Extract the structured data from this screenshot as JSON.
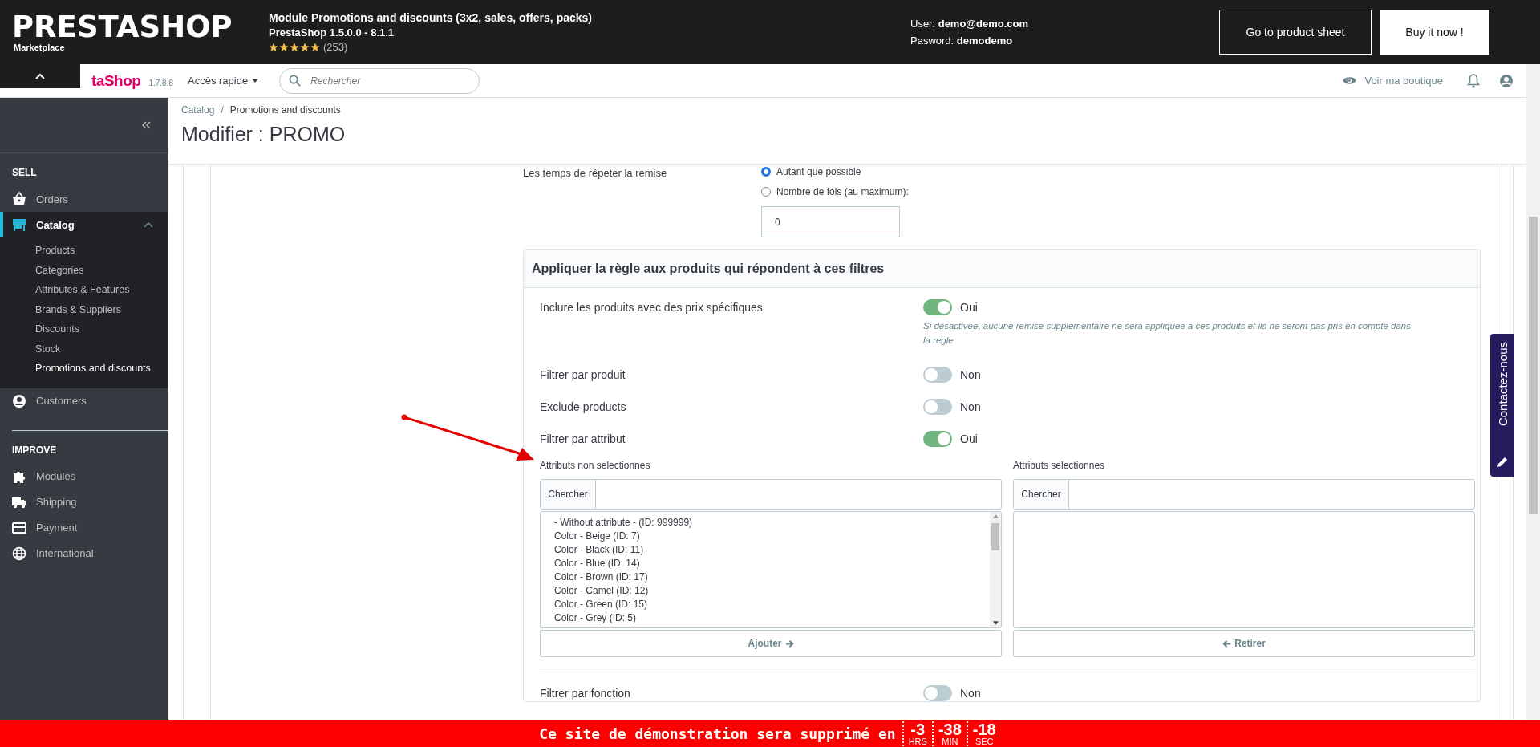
{
  "promo_bar": {
    "brand": "PRESTASHOP",
    "brand_sub": "Marketplace",
    "module_title": "Module Promotions and discounts (3x2, sales, offers, packs)",
    "compat": "PrestaShop 1.5.0.0 - 8.1.1",
    "stars": 5,
    "rating_count": "(253)",
    "user_label": "User:",
    "user": "demo@demo.com",
    "password_label": "Pasword:",
    "password": "demodemo",
    "buttons": [
      "Go to product sheet",
      "Buy it now !"
    ]
  },
  "header": {
    "logo_text": "taShop",
    "version": "1.7.8.8",
    "quick_access": "Accès rapide",
    "search": {
      "placeholder": "Rechercher"
    },
    "shop_link": "Voir ma boutique"
  },
  "sidebar": {
    "sections": [
      {
        "title": "SELL",
        "items": [
          {
            "label": "Orders",
            "selected": false,
            "expanded": false
          },
          {
            "label": "Catalog",
            "selected": true,
            "expanded": true,
            "children": [
              {
                "label": "Products",
                "selected": false
              },
              {
                "label": "Categories",
                "selected": false
              },
              {
                "label": "Attributes & Features",
                "selected": false
              },
              {
                "label": "Brands & Suppliers",
                "selected": false
              },
              {
                "label": "Discounts",
                "selected": false
              },
              {
                "label": "Stock",
                "selected": false
              },
              {
                "label": "Promotions and discounts",
                "selected": true
              }
            ]
          },
          {
            "label": "Customers",
            "selected": false,
            "expanded": false
          }
        ]
      },
      {
        "title": "IMPROVE",
        "items": [
          {
            "label": "Modules",
            "selected": false,
            "expanded": false
          },
          {
            "label": "Shipping",
            "selected": false,
            "expanded": false
          },
          {
            "label": "Payment",
            "selected": false,
            "expanded": false
          },
          {
            "label": "International",
            "selected": false,
            "expanded": false
          }
        ]
      }
    ]
  },
  "breadcrumb": [
    "Catalog",
    "Promotions and discounts"
  ],
  "breadcrumb_separator": "/",
  "page_title": "Modifier : PROMO",
  "repeat": {
    "label": "Les temps de répeter la remise",
    "options": [
      {
        "label": "Autant que possible",
        "selected": true
      },
      {
        "label": "Nombre de fois (au maximum):",
        "selected": false
      }
    ],
    "value": "0"
  },
  "filters_panel": {
    "title": "Appliquer la règle aux produits qui répondent à ces filtres",
    "rows": [
      {
        "label": "Inclure les produits avec des prix spécifiques",
        "on": true,
        "state_text": "Oui",
        "help": "Si desactivee, aucune remise supplementaire ne sera appliquee a ces produits et ils ne seront pas pris en compte dans la regle"
      },
      {
        "label": "Filtrer par produit",
        "on": false,
        "state_text": "Non"
      },
      {
        "label": "Exclude products",
        "on": false,
        "state_text": "Non"
      },
      {
        "label": "Filtrer par attribut",
        "on": true,
        "state_text": "Oui"
      }
    ],
    "attributes": {
      "available": {
        "title": "Attributs non selectionnes",
        "search_label": "Chercher",
        "items": [
          "- Without attribute - (ID: 999999)",
          "Color - Beige (ID: 7)",
          "Color - Black (ID: 11)",
          "Color - Blue (ID: 14)",
          "Color - Brown (ID: 17)",
          "Color - Camel (ID: 12)",
          "Color - Green (ID: 15)",
          "Color - Grey (ID: 5)"
        ],
        "button": "Ajouter"
      },
      "selected": {
        "title": "Attributs selectionnes",
        "search_label": "Chercher",
        "button": "Retirer"
      }
    },
    "after_rows": [
      {
        "label": "Filtrer par fonction",
        "on": false,
        "state_text": "Non"
      }
    ]
  },
  "contact_tab": "Contactez-nous",
  "demo_banner": {
    "text": "Ce site de démonstration sera supprimé en",
    "countdown": [
      {
        "value": "-3",
        "unit": "HRS"
      },
      {
        "value": "-38",
        "unit": "MIN"
      },
      {
        "value": "-18",
        "unit": "SEC"
      }
    ]
  }
}
